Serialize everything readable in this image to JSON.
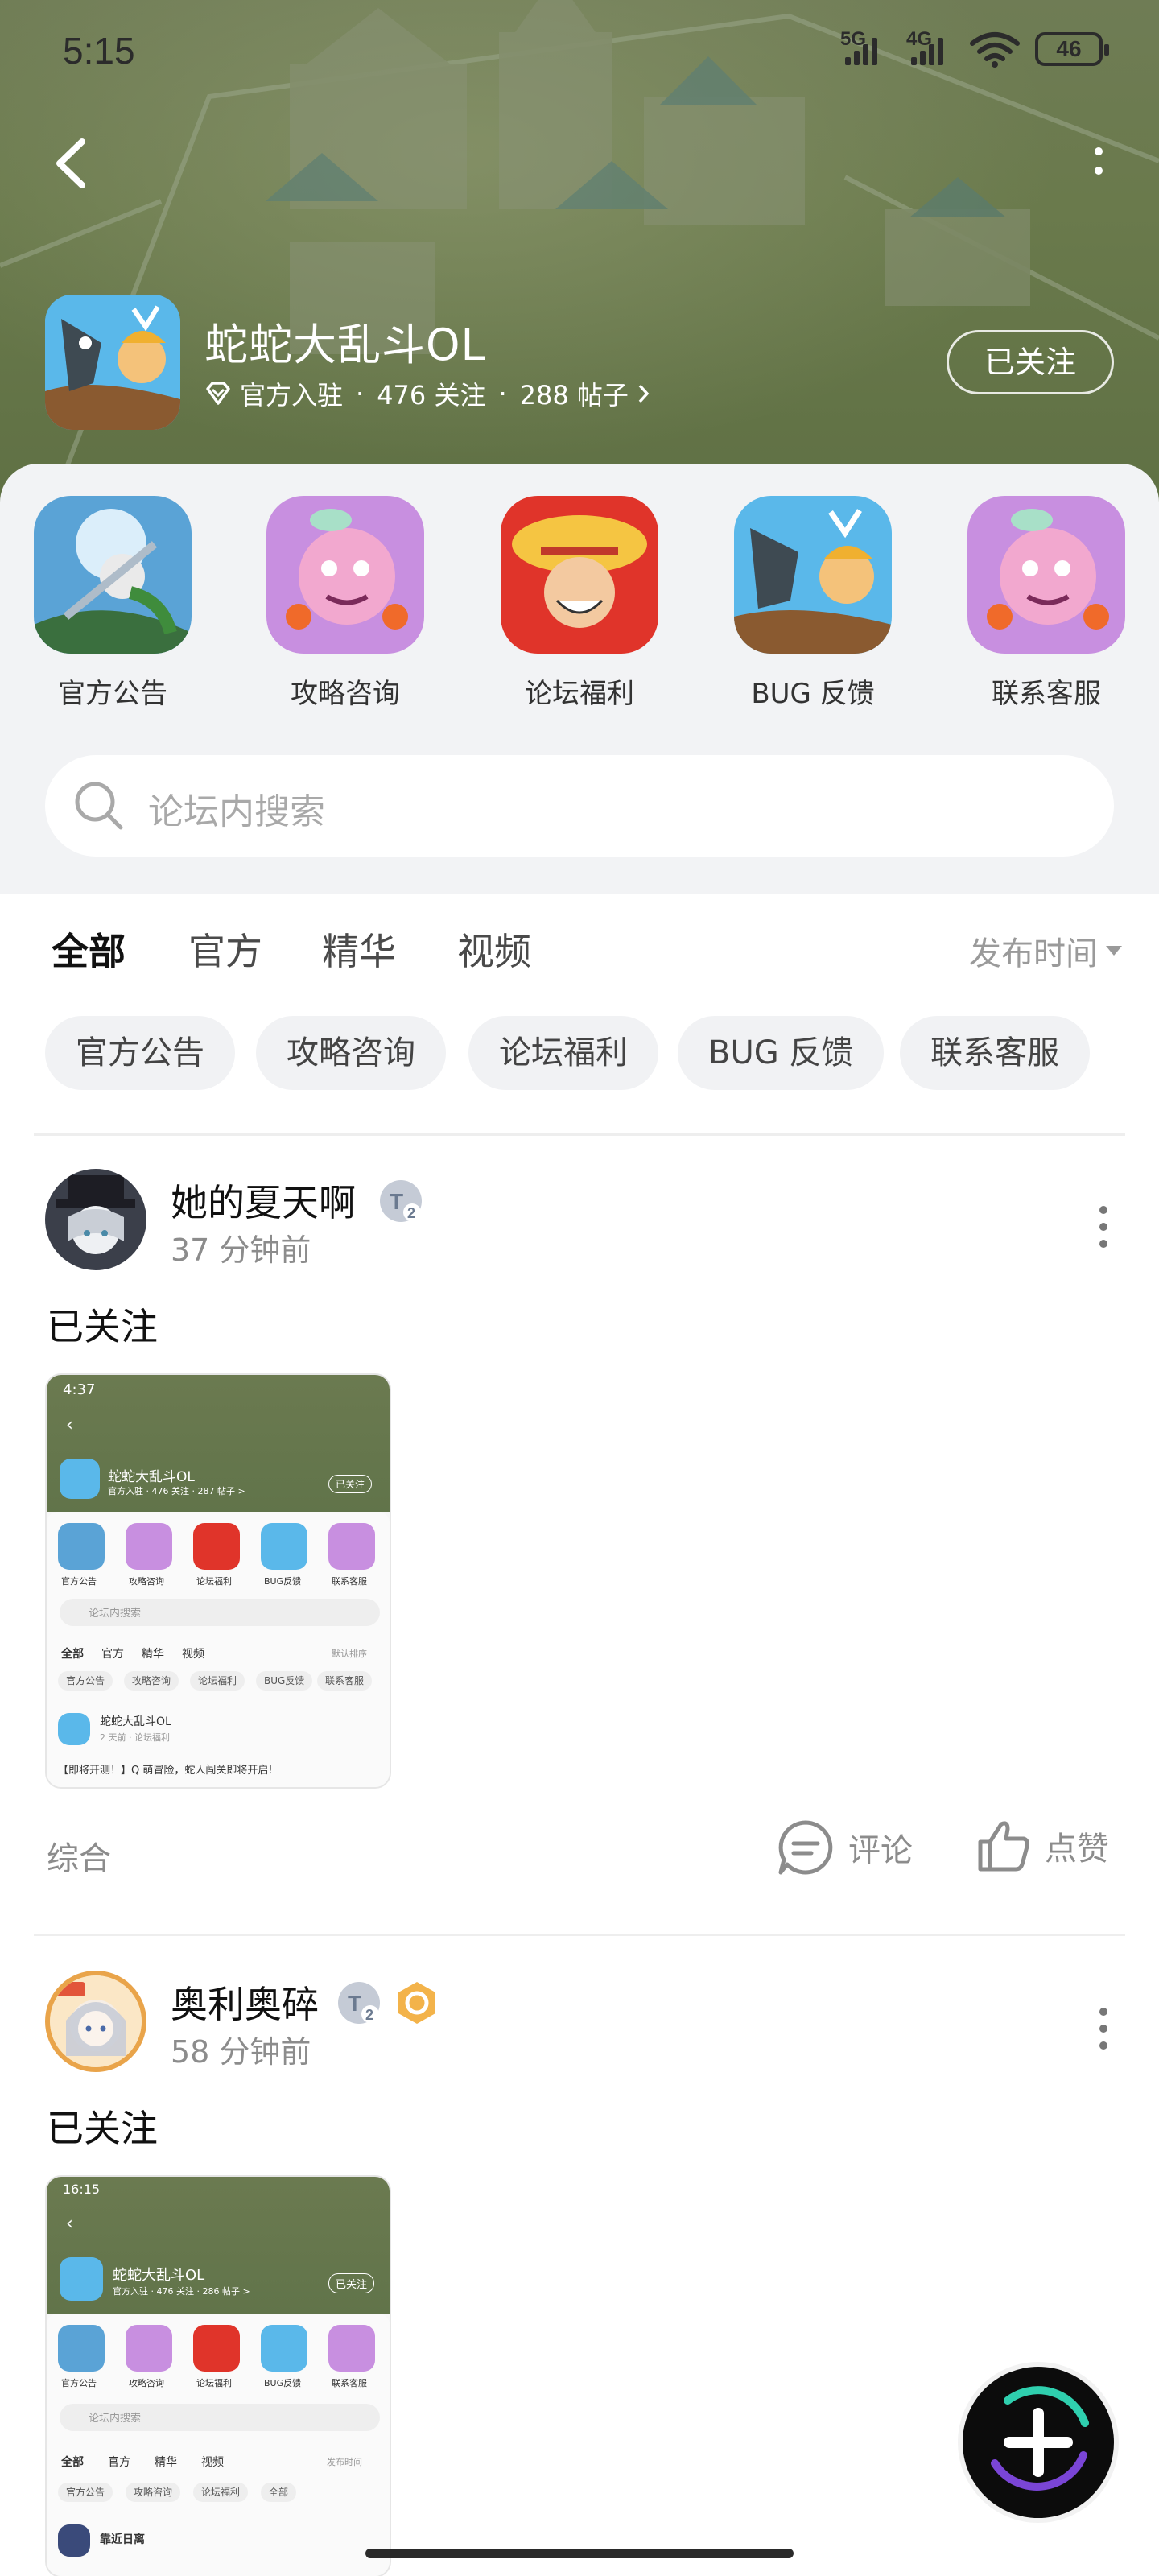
{
  "status_bar": {
    "time": "5:15",
    "net1": "5G",
    "net2": "4G",
    "battery": "46"
  },
  "header": {
    "app_name": "蛇蛇大乱斗OL",
    "verified": "官方入驻",
    "followers": "476 关注",
    "posts": "288 帖子",
    "follow_label": "已关注"
  },
  "quick_links": [
    {
      "label": "官方公告"
    },
    {
      "label": "攻略咨询"
    },
    {
      "label": "论坛福利"
    },
    {
      "label": "BUG 反馈"
    },
    {
      "label": "联系客服"
    }
  ],
  "search": {
    "placeholder": "论坛内搜索"
  },
  "tabs": [
    {
      "label": "全部",
      "active": true
    },
    {
      "label": "官方"
    },
    {
      "label": "精华"
    },
    {
      "label": "视频"
    }
  ],
  "sort_label": "发布时间",
  "chips": [
    "官方公告",
    "攻略咨询",
    "论坛福利",
    "BUG 反馈",
    "联系客服"
  ],
  "posts": [
    {
      "user": "她的夏天啊",
      "time": "37 分钟前",
      "text": "已关注",
      "category": "综合",
      "comment_label": "评论",
      "like_label": "点赞",
      "mini": {
        "time": "4:37",
        "name": "蛇蛇大乱斗OL",
        "meta": "官方入驻 · 476 关注 · 287 帖子 >",
        "follow": "已关注",
        "labels": [
          "官方公告",
          "攻略咨询",
          "论坛福利",
          "BUG反馈",
          "联系客服"
        ],
        "search": "论坛内搜索",
        "tabs": [
          "全部",
          "官方",
          "精华",
          "视频"
        ],
        "sort": "默认排序",
        "chips": [
          "官方公告",
          "攻略咨询",
          "论坛福利",
          "BUG反馈",
          "联系客服"
        ],
        "post_user": "蛇蛇大乱斗OL",
        "post_meta": "2 天前 · 论坛福利",
        "post_text": "【即将开测！】Q 萌冒险，蛇人闯关即将开启!"
      }
    },
    {
      "user": "奥利奥碎",
      "time": "58 分钟前",
      "text": "已关注",
      "mini": {
        "time": "16:15",
        "name": "蛇蛇大乱斗OL",
        "meta": "官方入驻 · 476 关注 · 286 帖子 >",
        "follow": "已关注",
        "labels": [
          "官方公告",
          "攻略咨询",
          "论坛福利",
          "BUG反馈",
          "联系客服"
        ],
        "search": "论坛内搜索",
        "tabs": [
          "全部",
          "官方",
          "精华",
          "视频"
        ],
        "sort": "发布时间",
        "chips": [
          "官方公告",
          "攻略咨询",
          "论坛福利",
          "全部"
        ],
        "post_user": "靠近日离"
      }
    }
  ],
  "colors": {
    "accent": "#2fcfae",
    "banner": "#6a7a4c"
  }
}
